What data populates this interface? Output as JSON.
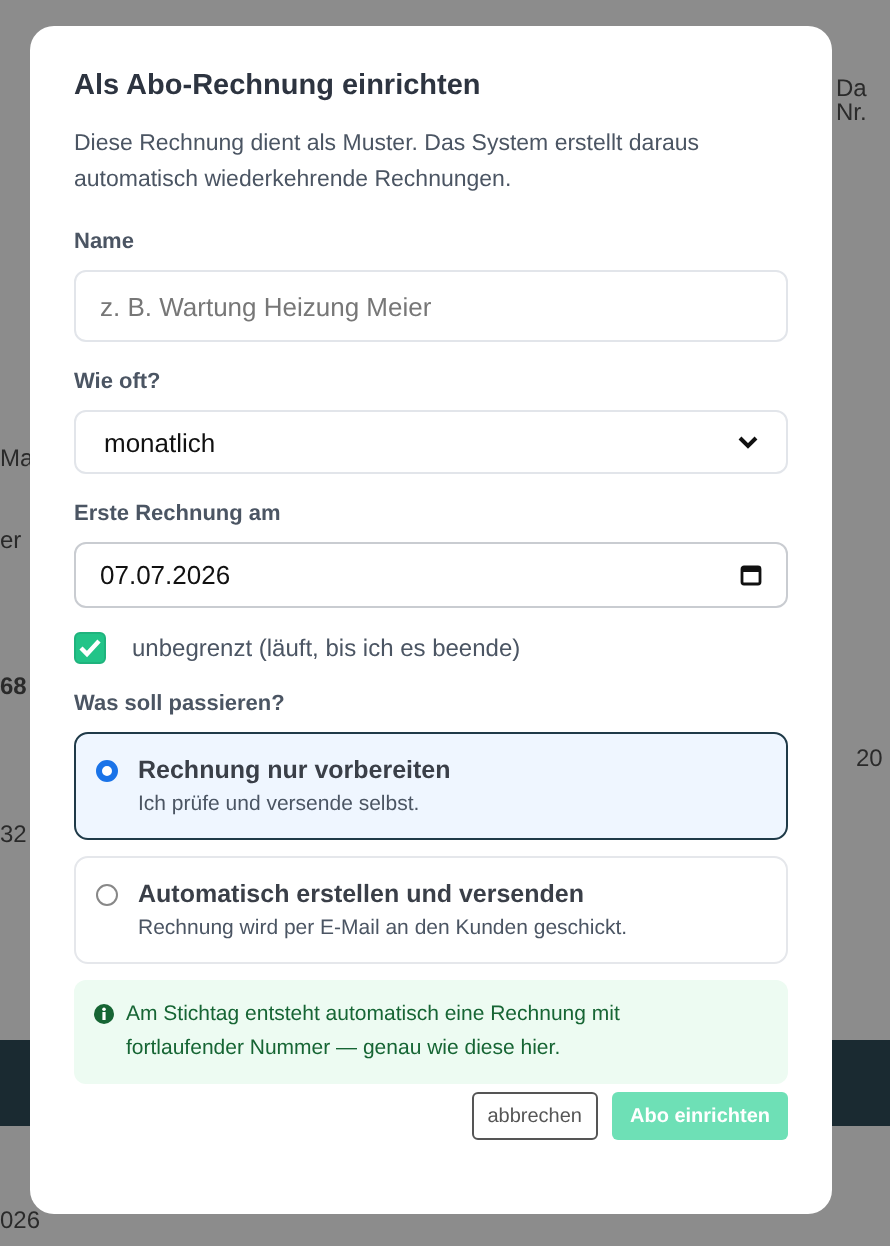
{
  "background_fragments": [
    {
      "text": "Da",
      "kind": "header"
    },
    {
      "text": "Nr.",
      "kind": "header"
    },
    {
      "text": "Ma",
      "kind": "cell"
    },
    {
      "text": "er",
      "kind": "cell"
    },
    {
      "text": "68",
      "kind": "bold"
    },
    {
      "text": "20",
      "kind": "cell"
    },
    {
      "text": "32",
      "kind": "cell"
    },
    {
      "text": "026",
      "kind": "cell"
    }
  ],
  "dialog": {
    "title": "Als Abo-Rechnung einrichten",
    "description": "Diese Rechnung dient als Muster. Das System erstellt daraus automatisch wiederkehrende Rechnungen.",
    "name_field": {
      "label": "Name",
      "placeholder": "z. B. Wartung Heizung Meier"
    },
    "frequency_field": {
      "label": "Wie oft?",
      "value": "monatlich"
    },
    "date_field": {
      "label": "Erste Rechnung am",
      "value": "07.07.2026"
    },
    "unlimited_checkbox": {
      "label": "unbegrenzt (läuft, bis ich es beende)",
      "checked": true
    },
    "action_group": {
      "label": "Was soll passieren?",
      "options": [
        {
          "title": "Rechnung nur vorbereiten",
          "subtitle": "Ich prüfe und versende selbst.",
          "selected": true
        },
        {
          "title": "Automatisch erstellen und versenden",
          "subtitle": "Rechnung wird per E-Mail an den Kunden geschickt.",
          "selected": false
        }
      ]
    },
    "info_note": "Am Stichtag entsteht automatisch eine Rechnung mit fortlaufender Nummer — genau wie diese hier.",
    "buttons": [
      {
        "label": "abbrechen",
        "kind": "secondary"
      },
      {
        "label": "Abo einrichten",
        "kind": "primary"
      }
    ]
  }
}
